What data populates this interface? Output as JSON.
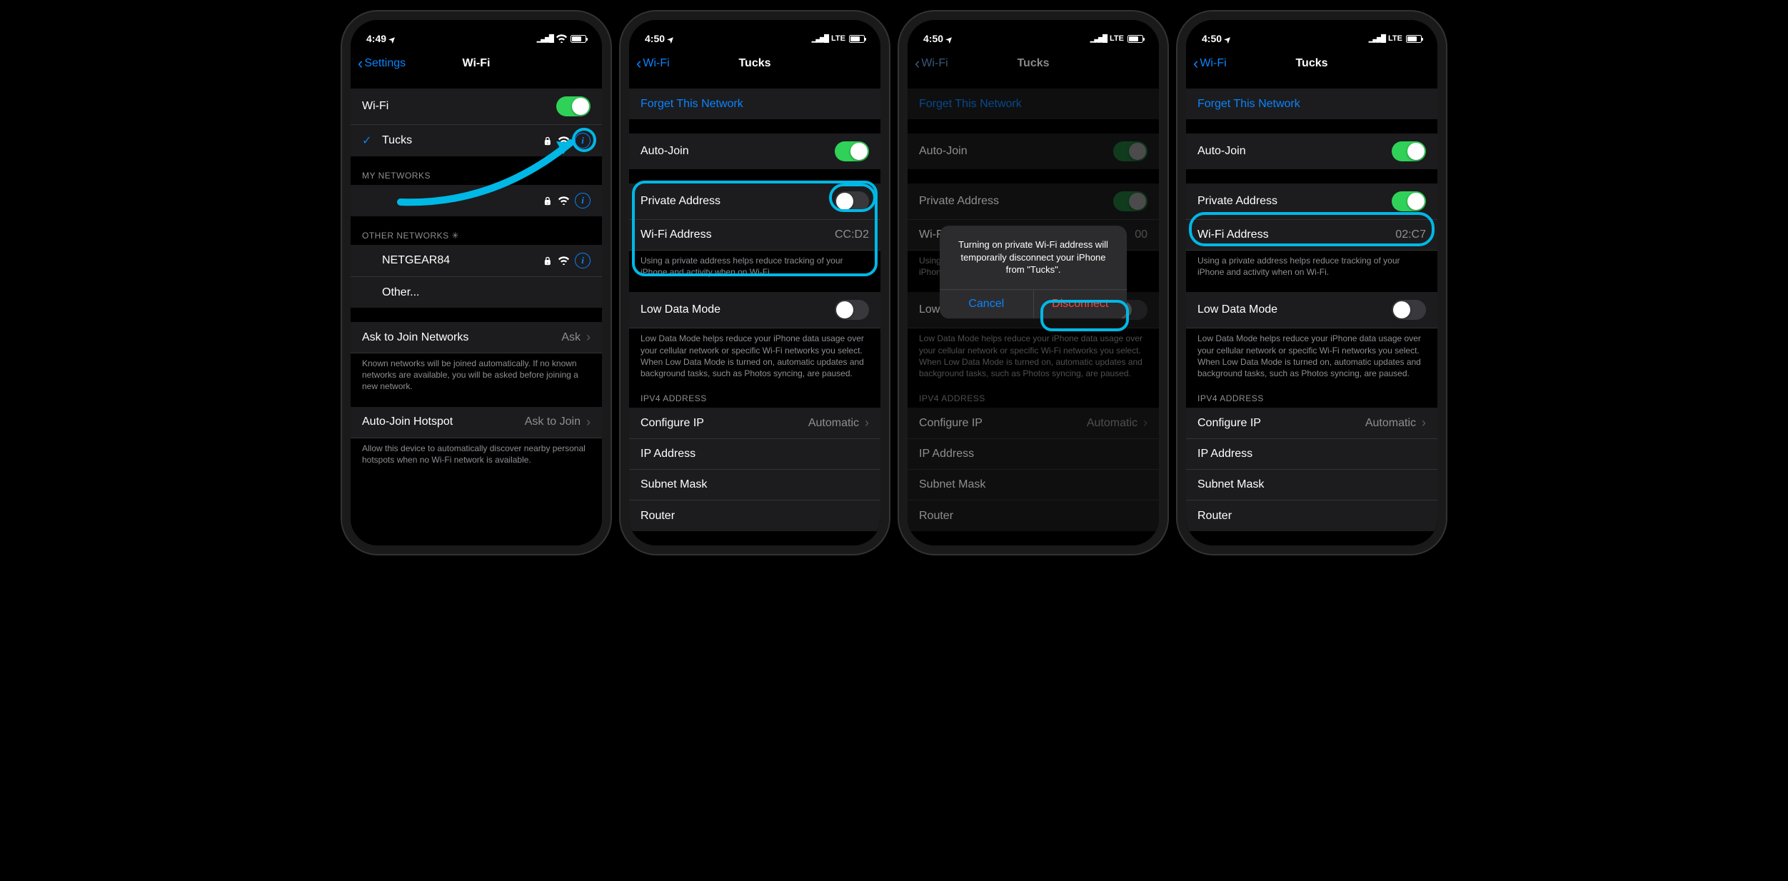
{
  "screens": [
    {
      "status": {
        "time": "4:49",
        "net": "wifi"
      },
      "back": "Settings",
      "title": "Wi-Fi",
      "wifi_label": "Wi-Fi",
      "connected": "Tucks",
      "my_hdr": "MY NETWORKS",
      "other_hdr": "OTHER NETWORKS",
      "other_items": [
        "NETGEAR84",
        "Other..."
      ],
      "ask_label": "Ask to Join Networks",
      "ask_val": "Ask",
      "ask_ftr": "Known networks will be joined automatically. If no known networks are available, you will be asked before joining a new network.",
      "auto_hs_label": "Auto-Join Hotspot",
      "auto_hs_val": "Ask to Join",
      "auto_hs_ftr": "Allow this device to automatically discover nearby personal hotspots when no Wi-Fi network is available."
    },
    {
      "status": {
        "time": "4:50",
        "net": "LTE"
      },
      "back": "Wi-Fi",
      "title": "Tucks",
      "forget": "Forget This Network",
      "autojoin": "Auto-Join",
      "priv_label": "Private Address",
      "priv_on": false,
      "wifi_addr_label": "Wi-Fi Address",
      "wifi_addr_val": "CC:D2",
      "priv_ftr": "Using a private address helps reduce tracking of your iPhone and activity when on Wi-Fi.",
      "low_label": "Low Data Mode",
      "low_ftr": "Low Data Mode helps reduce your iPhone data usage over your cellular network or specific Wi-Fi networks you select. When Low Data Mode is turned on, automatic updates and background tasks, such as Photos syncing, are paused.",
      "ipv4_hdr": "IPV4 ADDRESS",
      "cfg_label": "Configure IP",
      "cfg_val": "Automatic",
      "ip_label": "IP Address",
      "mask_label": "Subnet Mask",
      "router_label": "Router"
    },
    {
      "status": {
        "time": "4:50",
        "net": "LTE"
      },
      "back": "Wi-Fi",
      "title": "Tucks",
      "forget": "Forget This Network",
      "autojoin": "Auto-Join",
      "priv_label": "Private Address",
      "priv_on": true,
      "wifi_addr_label": "Wi-Fi Address",
      "wifi_addr_val": "00",
      "priv_ftr": "Using a private address helps reduce tracking of your iPhone and activity when on Wi-Fi.",
      "low_label": "Low Data Mode",
      "low_ftr": "Low Data Mode helps reduce your iPhone data usage over your cellular network or specific Wi-Fi networks you select. When Low Data Mode is turned on, automatic updates and background tasks, such as Photos syncing, are paused.",
      "ipv4_hdr": "IPV4 ADDRESS",
      "cfg_label": "Configure IP",
      "cfg_val": "Automatic",
      "ip_label": "IP Address",
      "mask_label": "Subnet Mask",
      "router_label": "Router",
      "alert_msg": "Turning on private Wi-Fi address will temporarily disconnect your iPhone from \"Tucks\".",
      "alert_cancel": "Cancel",
      "alert_disconnect": "Disconnect"
    },
    {
      "status": {
        "time": "4:50",
        "net": "LTE"
      },
      "back": "Wi-Fi",
      "title": "Tucks",
      "forget": "Forget This Network",
      "autojoin": "Auto-Join",
      "priv_label": "Private Address",
      "priv_on": true,
      "wifi_addr_label": "Wi-Fi Address",
      "wifi_addr_val": "02:C7",
      "priv_ftr": "Using a private address helps reduce tracking of your iPhone and activity when on Wi-Fi.",
      "low_label": "Low Data Mode",
      "low_ftr": "Low Data Mode helps reduce your iPhone data usage over your cellular network or specific Wi-Fi networks you select. When Low Data Mode is turned on, automatic updates and background tasks, such as Photos syncing, are paused.",
      "ipv4_hdr": "IPV4 ADDRESS",
      "cfg_label": "Configure IP",
      "cfg_val": "Automatic",
      "ip_label": "IP Address",
      "mask_label": "Subnet Mask",
      "router_label": "Router"
    }
  ]
}
